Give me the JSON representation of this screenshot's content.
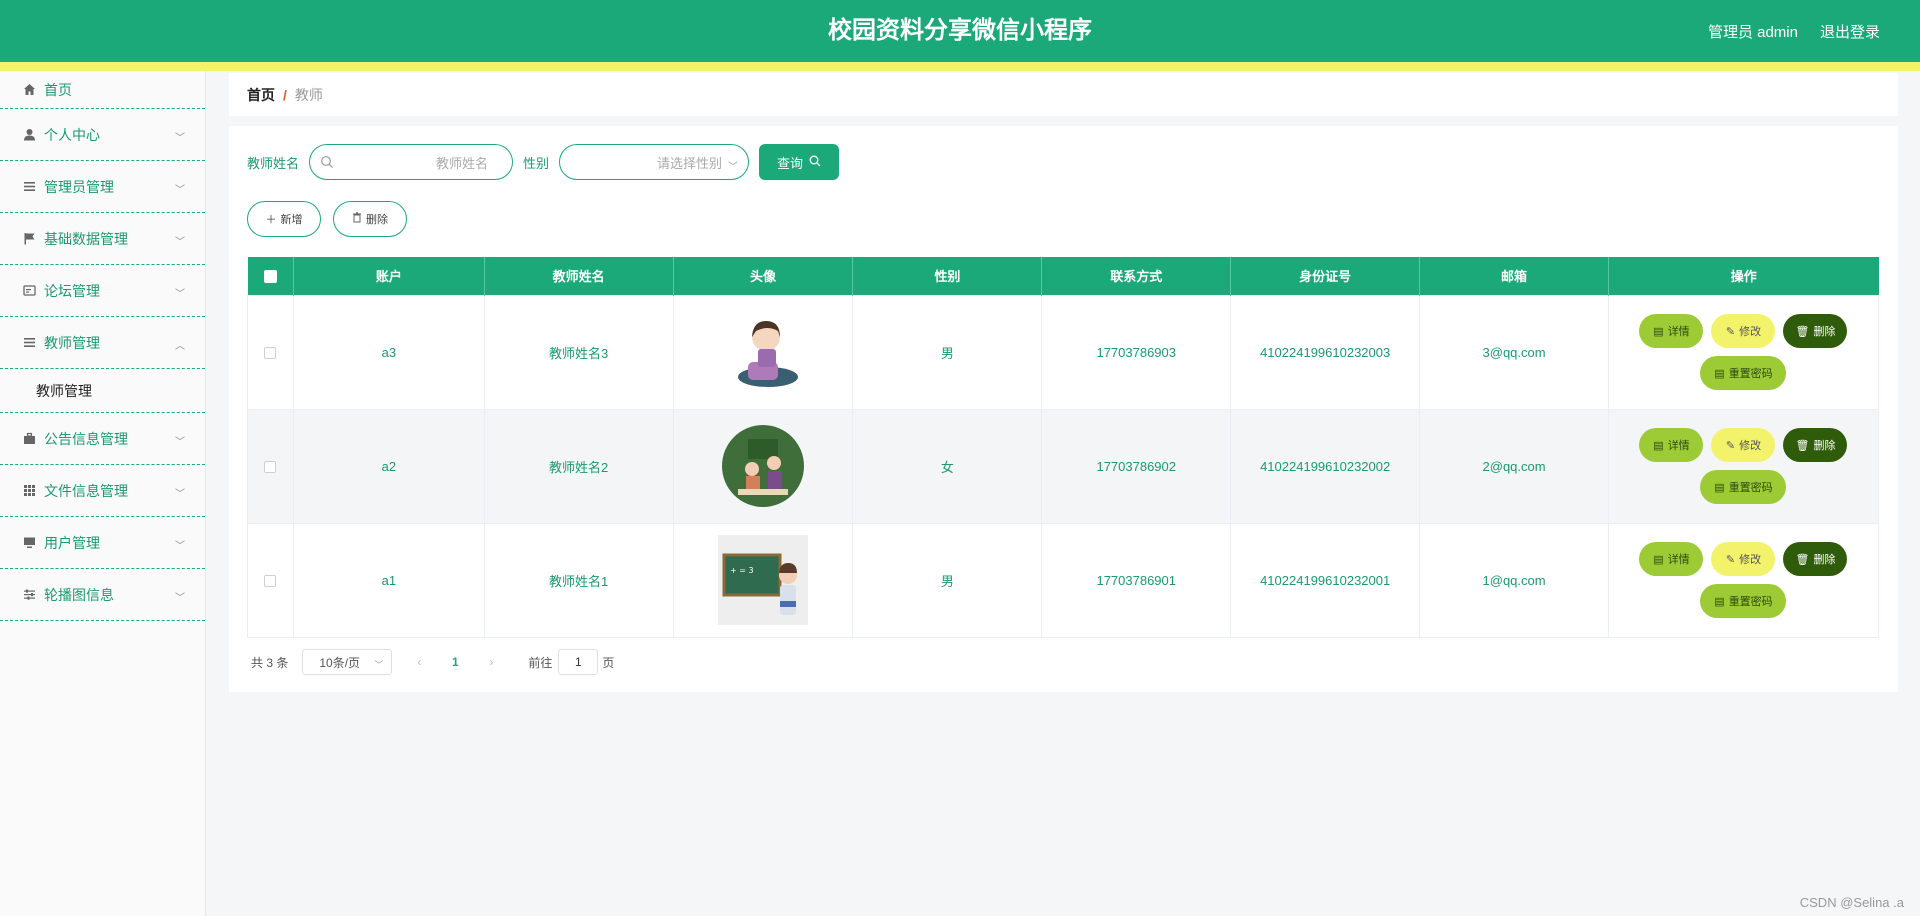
{
  "header": {
    "title": "校园资料分享微信小程序",
    "user": "管理员 admin",
    "logout": "退出登录"
  },
  "sidebar": {
    "items": [
      {
        "label": "首页",
        "icon": "home-icon"
      },
      {
        "label": "个人中心",
        "icon": "user-icon"
      },
      {
        "label": "管理员管理",
        "icon": "list-icon"
      },
      {
        "label": "基础数据管理",
        "icon": "flag-icon"
      },
      {
        "label": "论坛管理",
        "icon": "forum-icon"
      },
      {
        "label": "教师管理",
        "icon": "list-icon",
        "expanded": true
      },
      {
        "label": "公告信息管理",
        "icon": "briefcase-icon"
      },
      {
        "label": "文件信息管理",
        "icon": "grid-icon"
      },
      {
        "label": "用户管理",
        "icon": "monitor-icon"
      },
      {
        "label": "轮播图信息",
        "icon": "sliders-icon"
      }
    ],
    "submenu": "教师管理"
  },
  "breadcrumb": {
    "home": "首页",
    "separator": "/",
    "current": "教师"
  },
  "search": {
    "name_label": "教师姓名",
    "name_placeholder": "教师姓名",
    "gender_label": "性别",
    "gender_placeholder": "请选择性别",
    "query_button": "查询"
  },
  "actions": {
    "add": "新增",
    "delete": "删除"
  },
  "table": {
    "columns": [
      "账户",
      "教师姓名",
      "头像",
      "性别",
      "联系方式",
      "身份证号",
      "邮箱",
      "操作"
    ],
    "rows": [
      {
        "account": "a3",
        "name": "教师姓名3",
        "gender": "男",
        "phone": "17703786903",
        "id_card": "410224199610232003",
        "email": "3@qq.com"
      },
      {
        "account": "a2",
        "name": "教师姓名2",
        "gender": "女",
        "phone": "17703786902",
        "id_card": "410224199610232002",
        "email": "2@qq.com"
      },
      {
        "account": "a1",
        "name": "教师姓名1",
        "gender": "男",
        "phone": "17703786901",
        "id_card": "410224199610232001",
        "email": "1@qq.com"
      }
    ],
    "ops": {
      "detail": "详情",
      "edit": "修改",
      "delete": "删除",
      "reset": "重置密码"
    }
  },
  "pager": {
    "total": "共 3 条",
    "page_size": "10条/页",
    "current_page": "1",
    "goto_label": "前往",
    "goto_value": "1",
    "goto_suffix": "页"
  },
  "watermark": "CSDN @Selina .a",
  "colors": {
    "primary": "#1ca97a",
    "accent_yellow": "#f3f36b",
    "op_green": "#9ccb35",
    "op_dark": "#2f5c0a"
  }
}
